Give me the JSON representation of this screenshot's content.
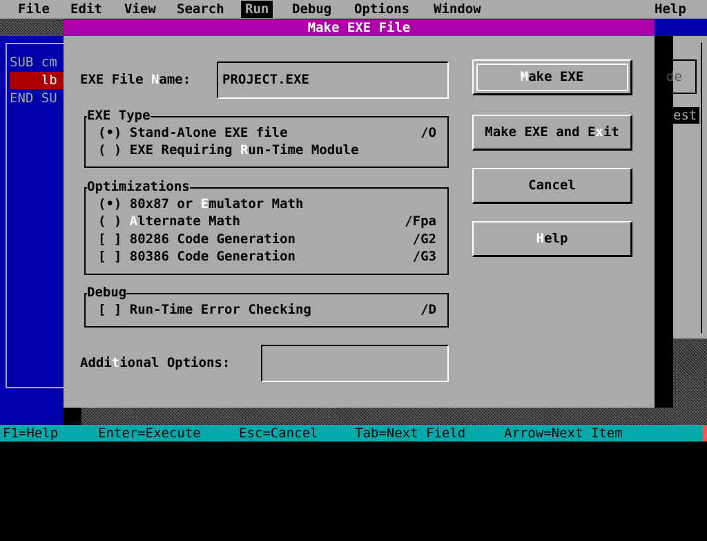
{
  "menu": {
    "items": [
      "File",
      "Edit",
      "View",
      "Search",
      "Run",
      "Debug",
      "Options",
      "Window",
      "Help"
    ],
    "active": "Run"
  },
  "editor": {
    "lines": [
      "SUB cm",
      "    lb",
      "END SU"
    ]
  },
  "background_window": {
    "button_fragment": "de",
    "highlight_fragment": "est)"
  },
  "dialog": {
    "title": "Make EXE File",
    "exe_name": {
      "label": {
        "pre": "EXE File ",
        "hot": "N",
        "post": "ame:"
      },
      "value": "PROJECT.EXE"
    },
    "exe_type": {
      "title": "EXE Type",
      "options": [
        {
          "mark": "(•)",
          "pre": " Stand-Alone EXE file",
          "hot": "",
          "post": "",
          "switch": "/O"
        },
        {
          "mark": "( )",
          "pre": " EXE Requiring ",
          "hot": "R",
          "post": "un-Time Module",
          "switch": ""
        }
      ]
    },
    "optimizations": {
      "title": "Optimizations",
      "options": [
        {
          "mark": "(•)",
          "pre": " 80x87 or ",
          "hot": "E",
          "post": "mulator Math",
          "switch": ""
        },
        {
          "mark": "( )",
          "pre": " ",
          "hot": "A",
          "post": "lternate Math",
          "switch": "/Fpa"
        },
        {
          "mark": "[ ]",
          "pre": " 80286 Code Generation",
          "hot": "",
          "post": "",
          "switch": "/G2"
        },
        {
          "mark": "[ ]",
          "pre": " 80386 Code Generation",
          "hot": "",
          "post": "",
          "switch": "/G3"
        }
      ]
    },
    "debug": {
      "title": "Debug",
      "options": [
        {
          "mark": "[ ]",
          "pre": " Run-Time Error Checking",
          "hot": "",
          "post": "",
          "switch": "/D"
        }
      ]
    },
    "additional": {
      "label": {
        "pre": "Addi",
        "hot": "t",
        "post": "ional Options:"
      },
      "value": ""
    },
    "buttons": [
      {
        "pre": "",
        "hot": "M",
        "post": "ake EXE"
      },
      {
        "pre": "Make EXE and E",
        "hot": "x",
        "post": "it"
      },
      {
        "pre": "Cancel",
        "hot": "",
        "post": ""
      },
      {
        "pre": "",
        "hot": "H",
        "post": "elp"
      }
    ]
  },
  "status": [
    "F1=Help",
    "Enter=Execute",
    "Esc=Cancel",
    "Tab=Next Field",
    "Arrow=Next Item"
  ],
  "colors": {
    "menu": "#aaaaaa",
    "title": "#aa00aa",
    "editor": "#0000aa",
    "status": "#00aaaa",
    "hotkey": "#ffffff"
  }
}
